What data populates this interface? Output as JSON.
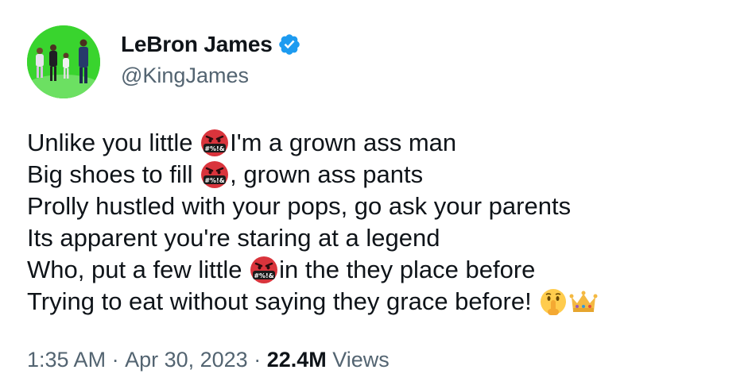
{
  "author": {
    "display_name": "LeBron James",
    "handle": "@KingJames",
    "verified": true,
    "verified_color": "#1d9bf0"
  },
  "tweet": {
    "lines": [
      {
        "before": "Unlike you little ",
        "emoji": "face-with-symbols-on-mouth",
        "after": "I'm a grown ass man"
      },
      {
        "before": "Big shoes to fill ",
        "emoji": "face-with-symbols-on-mouth",
        "after": ", grown ass pants"
      },
      {
        "before": "Prolly hustled with your pops, go ask your parents",
        "emoji": null,
        "after": ""
      },
      {
        "before": "Its apparent you're staring at a legend",
        "emoji": null,
        "after": ""
      },
      {
        "before": "Who, put a few little ",
        "emoji": "face-with-symbols-on-mouth",
        "after": "in the they place before"
      },
      {
        "before": "Trying to eat without saying they grace before! ",
        "emoji": "shushing-face",
        "emoji2": "crown",
        "after": ""
      }
    ]
  },
  "meta": {
    "time": "1:35 AM",
    "separator": " · ",
    "date": "Apr 30, 2023",
    "views_count": "22.4M",
    "views_label": " Views"
  },
  "emoji_text": {
    "symbols": "#%!&"
  },
  "colors": {
    "text_primary": "#0f1419",
    "text_secondary": "#536471",
    "angry_face": "#d9343c",
    "avatar_bg": "#39d42e"
  }
}
